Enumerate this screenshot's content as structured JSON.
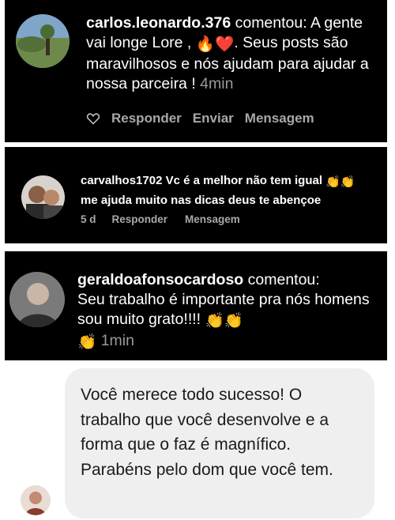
{
  "comments": [
    {
      "username": "carlos.leonardo.376",
      "verb": "comentou:",
      "text_part1": "A gente vai longe Lore ,",
      "emoji_1": "🔥",
      "emoji_2": "❤️",
      "text_part2": ". Seus posts são maravilhosos e nós ajudam para ajudar a nossa parceira !",
      "time": "4min",
      "reply_label": "Responder",
      "send_label": "Enviar",
      "message_label": "Mensagem"
    },
    {
      "username": "carvalhos1702",
      "text_part1": "Vc é a melhor não tem igual",
      "emoji_1": "👏👏",
      "text_part2": "me ajuda muito nas dicas deus te abençoe",
      "time": "5 d",
      "reply_label": "Responder",
      "message_label": "Mensagem"
    },
    {
      "username": "geraldoafonsocardoso",
      "verb": "comentou:",
      "text_part1": "Seu trabalho é importante pra nós homens sou muito grato!!!!",
      "emoji_1": "👏👏",
      "emoji_2": "👏",
      "time": "1min"
    }
  ],
  "message_bubble": {
    "text": "Você merece todo sucesso! O trabalho que você desenvolve e a forma que o faz é magnífico. Parabéns pelo dom que você tem."
  },
  "icons": {
    "like": "heart-outline-icon"
  }
}
